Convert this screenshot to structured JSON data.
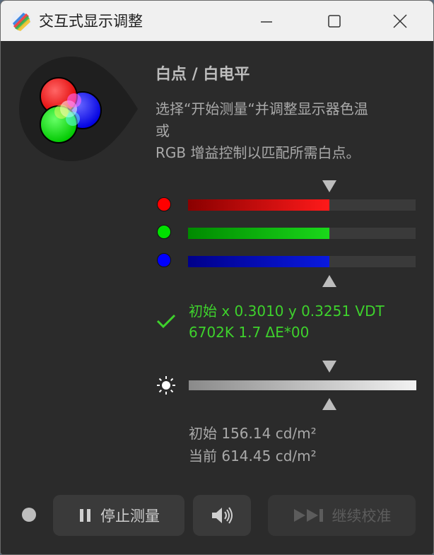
{
  "window": {
    "title": "交互式显示调整"
  },
  "panel": {
    "heading": "白点 / 白电平",
    "description_lines": [
      "选择“开始测量“并调整显示器色温",
      "或",
      "RGB 增益控制以匹配所需白点。"
    ]
  },
  "rgb_gains": {
    "target_fraction": 0.62,
    "channels": [
      {
        "name": "red",
        "level": 0.62,
        "dot_color": "#ff0000",
        "bar_color_start": "#8a0000",
        "bar_color_end": "#ff1a1a"
      },
      {
        "name": "green",
        "level": 0.62,
        "dot_color": "#00e000",
        "bar_color_start": "#008a00",
        "bar_color_end": "#1ad81a"
      },
      {
        "name": "blue",
        "level": 0.62,
        "dot_color": "#0000ff",
        "bar_color_start": "#00008a",
        "bar_color_end": "#0a1adf"
      }
    ]
  },
  "status": {
    "line1": "初始 x 0.3010 y 0.3251 VDT",
    "line2": "6702K 1.7 ΔE*00",
    "color": "#3ed22c"
  },
  "luminance": {
    "target_fraction": 0.62,
    "initial": "初始 156.14 cd/m²",
    "current": "当前 614.45 cd/m²"
  },
  "buttons": {
    "stop_label": "停止测量",
    "continue_label": "继续校准"
  },
  "icons": [
    "app-logo-icon",
    "minimize-icon",
    "maximize-icon",
    "close-icon",
    "rgb-circles-icon",
    "check-icon",
    "brightness-sun-icon",
    "pause-icon",
    "speaker-icon",
    "skip-forward-icon"
  ]
}
